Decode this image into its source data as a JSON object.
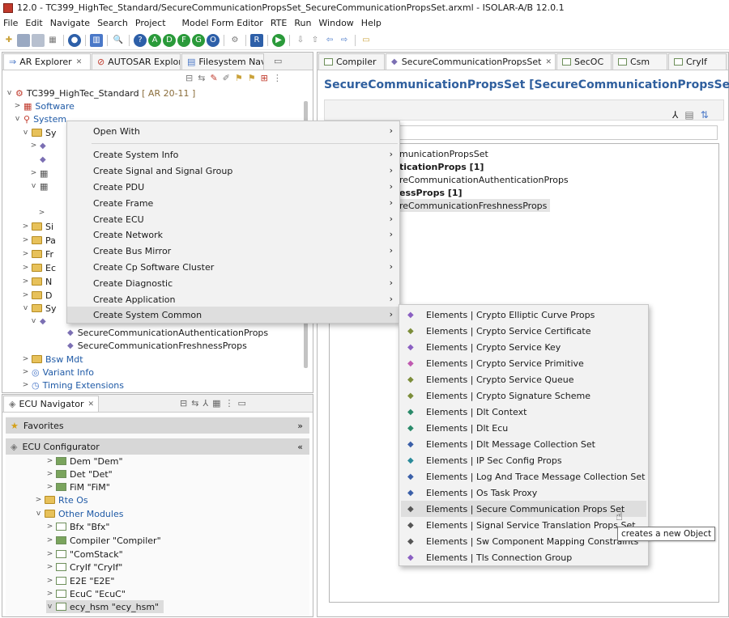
{
  "window": {
    "title": "12.0 - TC399_HighTec_Standard/SecureCommunicationPropsSet_SecureCommunicationPropsSet.arxml - ISOLAR-A/B 12.0.1"
  },
  "menubar": [
    "File",
    "Edit",
    "Navigate",
    "Search",
    "Project",
    "Model Form Editor",
    "RTE",
    "Run",
    "Window",
    "Help"
  ],
  "left_panel": {
    "tabs": [
      "AR Explorer",
      "AUTOSAR Explor",
      "Filesystem Navi"
    ],
    "tree": {
      "root": "TC399_HighTec_Standard",
      "root_version": "[ AR 20-11 ]",
      "software": "Software",
      "system": "System",
      "auth_props": "SecureCommunicationAuthenticationProps",
      "fresh_props": "SecureCommunicationFreshnessProps",
      "bsw_mdt": "Bsw Mdt",
      "variant_info": "Variant Info",
      "timing": "Timing Extensions",
      "partials": [
        "Sy",
        "Si",
        "Pa",
        "Fr",
        "Ec",
        "N",
        "D",
        "Sy"
      ]
    }
  },
  "ecu_nav": {
    "title": "ECU Navigator",
    "favorites": "Favorites",
    "configurator": "ECU Configurator",
    "items": [
      {
        "label": "Dem \"Dem\"",
        "kind": "module"
      },
      {
        "label": "Det \"Det\"",
        "kind": "module"
      },
      {
        "label": "FiM \"FiM\"",
        "kind": "module"
      },
      {
        "label": "Rte Os",
        "kind": "folder"
      },
      {
        "label": "Other Modules",
        "kind": "folder"
      },
      {
        "label": "Bfx \"Bfx\"",
        "kind": "module"
      },
      {
        "label": "Compiler \"Compiler\"",
        "kind": "module"
      },
      {
        "label": "\"ComStack\"",
        "kind": "module"
      },
      {
        "label": "CryIf \"CryIf\"",
        "kind": "module"
      },
      {
        "label": "E2E \"E2E\"",
        "kind": "module"
      },
      {
        "label": "EcuC \"EcuC\"",
        "kind": "module"
      },
      {
        "label": "ecy_hsm \"ecy_hsm\"",
        "kind": "module"
      }
    ]
  },
  "editor": {
    "tabs": [
      "Compiler",
      "SecureCommunicationPropsSet",
      "SecOC",
      "Csm",
      "CryIf"
    ],
    "title": "SecureCommunicationPropsSet [SecureCommunicationPropsSet]",
    "lines": [
      "municationPropsSet",
      "ticationProps [1]",
      "reCommunicationAuthenticationProps",
      "essProps [1]",
      "reCommunicationFreshnessProps"
    ]
  },
  "context_menu": {
    "items": [
      "Open With",
      "Create System Info",
      "Create Signal and Signal Group",
      "Create PDU",
      "Create Frame",
      "Create ECU",
      "Create Network",
      "Create Bus Mirror",
      "Create Cp Software Cluster",
      "Create Diagnostic",
      "Create Application",
      "Create System Common"
    ]
  },
  "submenu": {
    "items": [
      "Elements | Crypto Elliptic Curve Props",
      "Elements | Crypto Service Certificate",
      "Elements | Crypto Service Key",
      "Elements | Crypto Service Primitive",
      "Elements | Crypto Service Queue",
      "Elements | Crypto Signature Scheme",
      "Elements | Dlt Context",
      "Elements | Dlt Ecu",
      "Elements | Dlt Message Collection Set",
      "Elements | IP Sec Config Props",
      "Elements | Log And Trace Message Collection Set",
      "Elements | Os Task Proxy",
      "Elements | Secure Communication Props Set",
      "Elements | Signal Service Translation Props Set",
      "Elements | Sw Component Mapping Constraints",
      "Elements | Tls Connection Group"
    ]
  },
  "tooltip": "creates a new Object",
  "colors": {
    "accent": "#1f5aa6",
    "highlight": "#dedede"
  }
}
